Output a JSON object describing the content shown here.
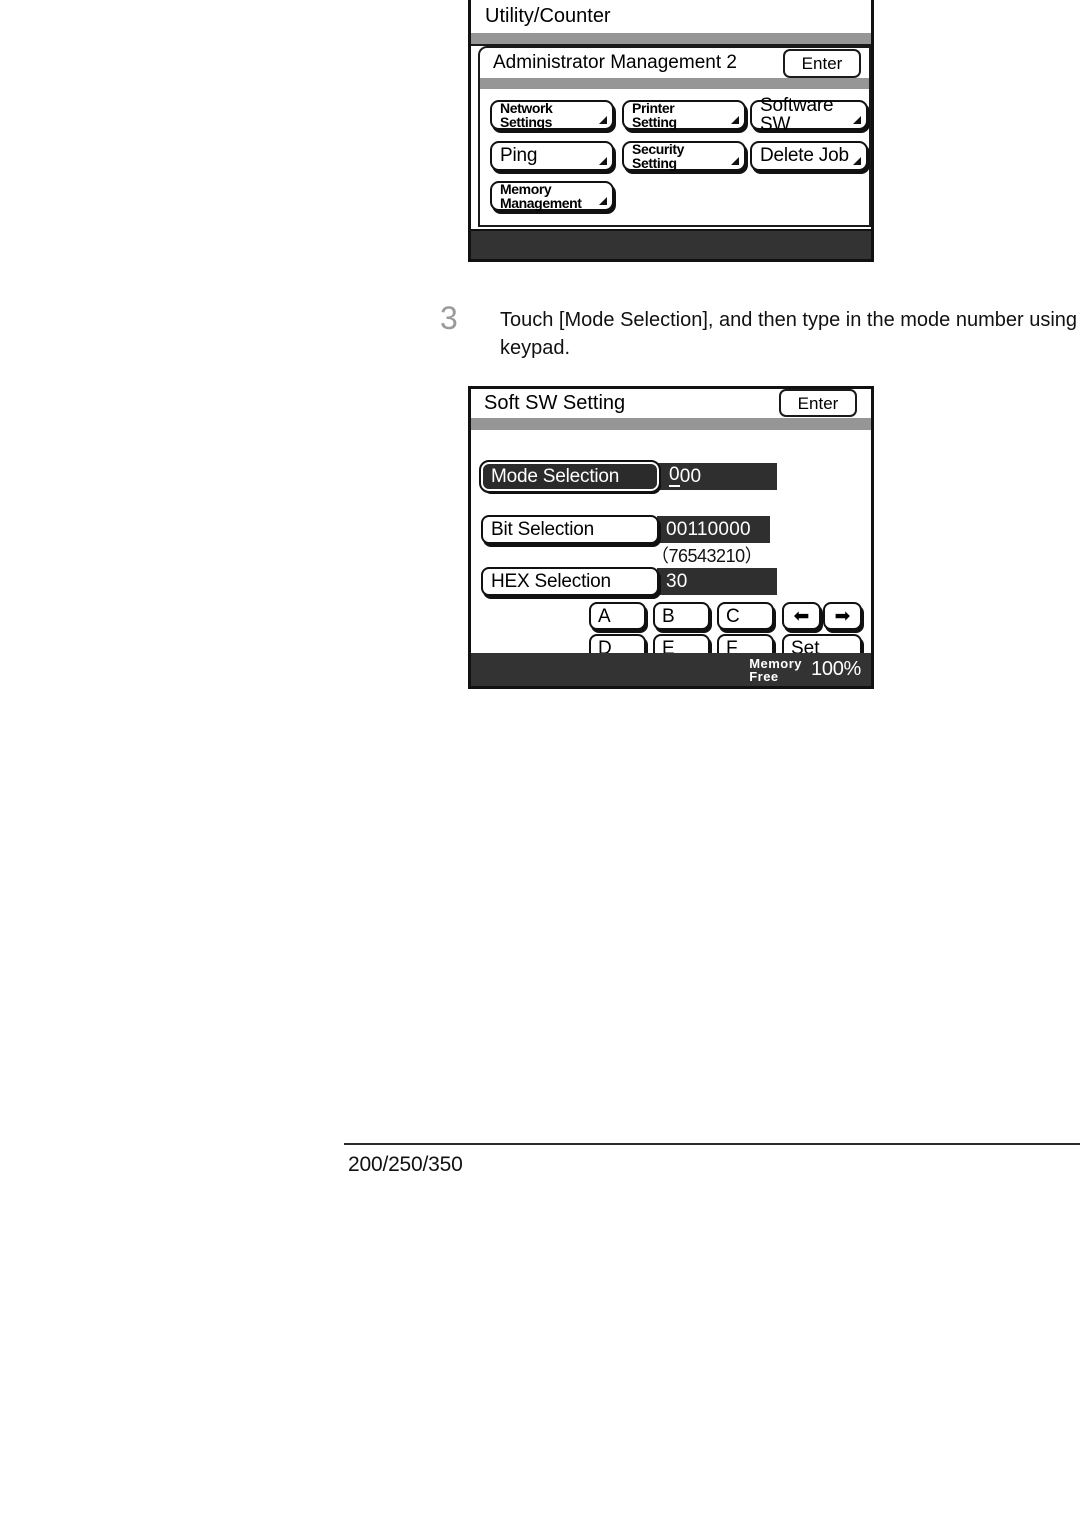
{
  "panel_utility": {
    "outer_title": "Utility/Counter",
    "sub_title": "Administrator Management 2",
    "enter_label": "Enter",
    "softkeys": [
      {
        "label": "Network\nSettings",
        "style": "small"
      },
      {
        "label": "Printer\nSetting",
        "style": "small"
      },
      {
        "label": "Software SW",
        "style": "big"
      },
      {
        "label": "Ping",
        "style": "big"
      },
      {
        "label": "Security\nSetting",
        "style": "small"
      },
      {
        "label": "Delete Job",
        "style": "big"
      },
      {
        "label": "Memory\nManagement",
        "style": "small"
      }
    ]
  },
  "step": {
    "number": "3",
    "text": "Touch [Mode Selection], and then type in the mode number using the keypad."
  },
  "panel_softsw": {
    "title": "Soft SW Setting",
    "enter_label": "Enter",
    "rows": [
      {
        "label": "Mode Selection",
        "value_cursor": "0",
        "value_rest": "00",
        "selected": true
      },
      {
        "label": "Bit Selection",
        "value_cursor": "",
        "value_rest": "00110000",
        "selected": false
      },
      {
        "label": "HEX Selection",
        "value_cursor": "",
        "value_rest": "30",
        "selected": false
      }
    ],
    "bit_legend": "（76543210）",
    "keypad": [
      {
        "key": "A"
      },
      {
        "key": "B"
      },
      {
        "key": "C"
      },
      {
        "key": "D"
      },
      {
        "key": "E"
      },
      {
        "key": "F"
      }
    ],
    "arrow_left": "⬅",
    "arrow_right": "➡",
    "set_label": "Set",
    "memory_free_label": "Memory\nFree",
    "memory_free_value": "100%"
  },
  "footer": {
    "model_numbers": "200/250/350"
  },
  "colors": {
    "gray_strip": "#969696",
    "dark_bar": "#333333",
    "value_field": "#2f2f2f",
    "step_number": "#9a9a9a"
  }
}
